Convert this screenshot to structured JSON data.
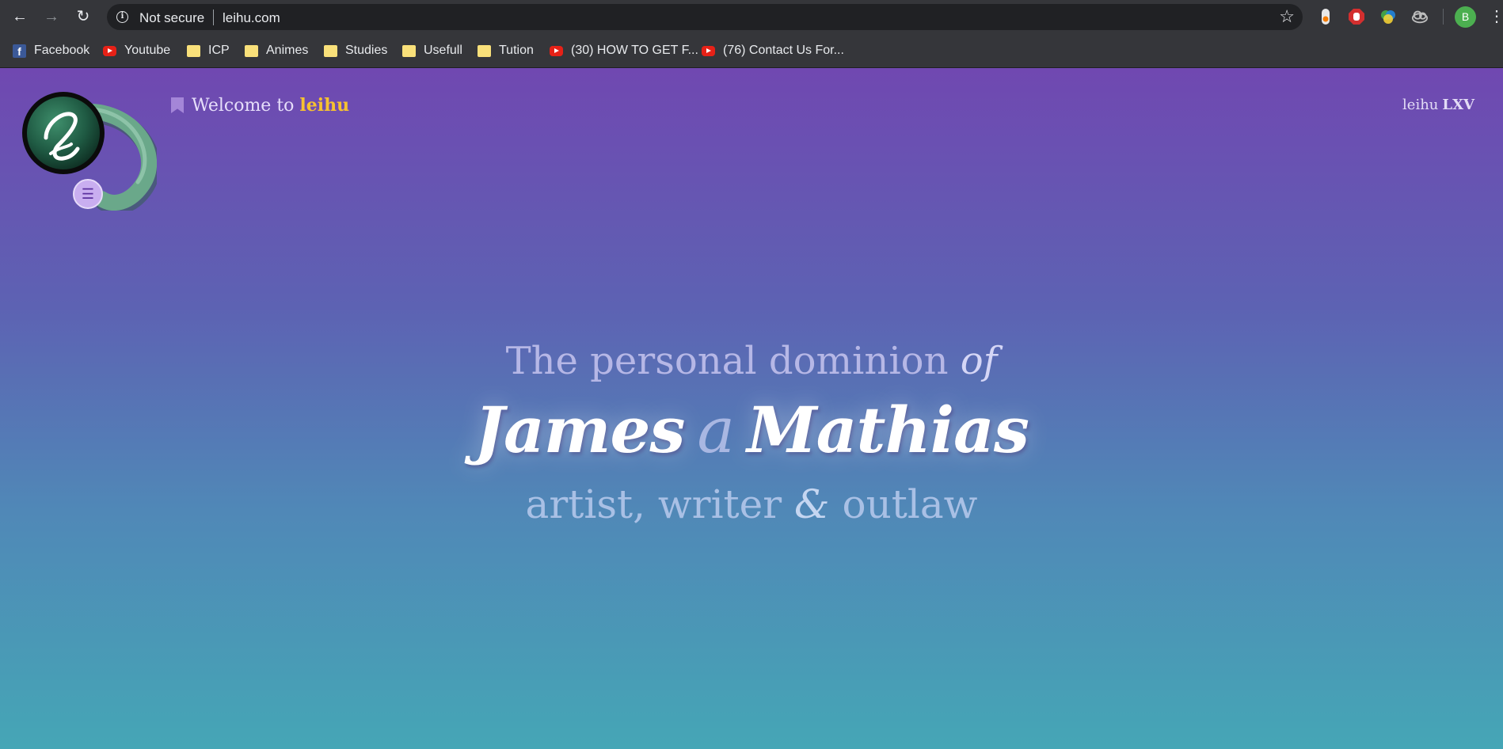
{
  "browser": {
    "security_label": "Not secure",
    "url": "leihu.com",
    "profile_initial": "B",
    "extensions": [
      "pencil-extension",
      "adblock-hand-extension",
      "color-pick-extension",
      "cloud-extension"
    ]
  },
  "bookmarks": [
    {
      "label": "Facebook",
      "icon": "facebook-icon"
    },
    {
      "label": "Youtube",
      "icon": "youtube-icon"
    },
    {
      "label": "ICP",
      "icon": "folder-icon"
    },
    {
      "label": "Animes",
      "icon": "folder-icon"
    },
    {
      "label": "Studies",
      "icon": "folder-icon"
    },
    {
      "label": "Usefull",
      "icon": "folder-icon"
    },
    {
      "label": "Tution",
      "icon": "folder-icon"
    },
    {
      "label": "(30) HOW TO GET F...",
      "icon": "youtube-icon"
    },
    {
      "label": "(76) Contact Us For...",
      "icon": "youtube-icon"
    }
  ],
  "site": {
    "welcome_prefix": "Welcome to",
    "brand": "leihu",
    "version_name": "leihu",
    "version_number": "LXV",
    "hero": {
      "line1": "The personal dominion",
      "line1_of": "of",
      "first_name": "James",
      "middle": "a",
      "last_name": "Mathias",
      "line3_a": "artist, writer",
      "line3_amp": "&",
      "line3_b": "outlaw"
    },
    "colors": {
      "gradient_top": "#7048b1",
      "gradient_bottom": "#45a6b6",
      "brand_accent": "#f6c230"
    }
  }
}
